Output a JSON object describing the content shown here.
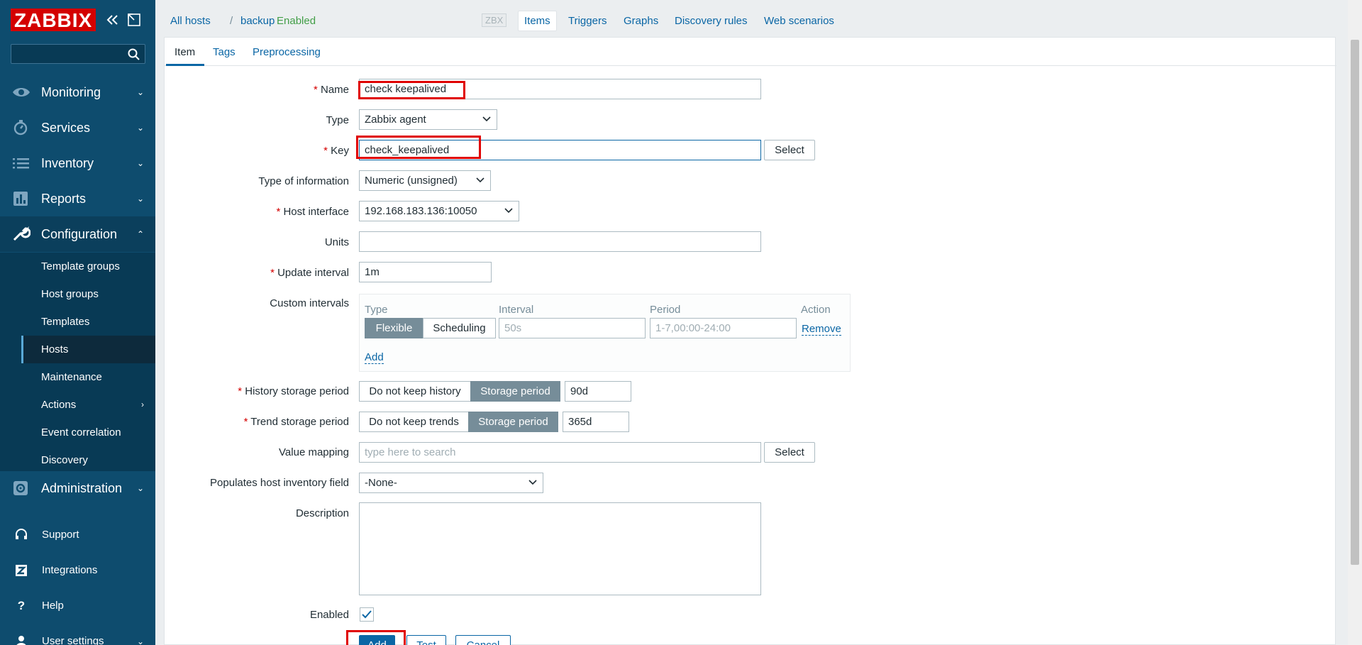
{
  "sidebar": {
    "logo": "ZABBIX",
    "search_placeholder": "",
    "menu": [
      {
        "label": "Monitoring",
        "icon": "eye-icon"
      },
      {
        "label": "Services",
        "icon": "stopwatch-icon"
      },
      {
        "label": "Inventory",
        "icon": "list-icon"
      },
      {
        "label": "Reports",
        "icon": "bar-chart-icon"
      },
      {
        "label": "Configuration",
        "icon": "wrench-icon"
      }
    ],
    "submenu": [
      "Template groups",
      "Host groups",
      "Templates",
      "Hosts",
      "Maintenance",
      "Actions",
      "Event correlation",
      "Discovery"
    ],
    "admin": {
      "label": "Administration",
      "icon": "gear-icon"
    },
    "utility": [
      {
        "label": "Support",
        "icon": "headset-icon"
      },
      {
        "label": "Integrations",
        "icon": "integrations-icon"
      },
      {
        "label": "Help",
        "icon": "help-icon"
      },
      {
        "label": "User settings",
        "icon": "user-icon"
      }
    ]
  },
  "breadcrumb": {
    "all_hosts": "All hosts",
    "sep": "/",
    "host": "backup",
    "status": "Enabled",
    "zbx": "ZBX",
    "items": "Items",
    "triggers": "Triggers",
    "graphs": "Graphs",
    "discovery": "Discovery rules",
    "web": "Web scenarios"
  },
  "form_tabs": [
    "Item",
    "Tags",
    "Preprocessing"
  ],
  "form": {
    "name_label": "Name",
    "name_value": "check keepalived",
    "type_label": "Type",
    "type_value": "Zabbix agent",
    "key_label": "Key",
    "key_value": "check_keepalived",
    "key_select": "Select",
    "toi_label": "Type of information",
    "toi_value": "Numeric (unsigned)",
    "hi_label": "Host interface",
    "hi_value": "192.168.183.136:10050",
    "units_label": "Units",
    "units_value": "",
    "update_label": "Update interval",
    "update_value": "1m",
    "custom_label": "Custom intervals",
    "custom": {
      "h_type": "Type",
      "h_interval": "Interval",
      "h_period": "Period",
      "h_action": "Action",
      "flexible": "Flexible",
      "scheduling": "Scheduling",
      "interval_ph": "50s",
      "period_ph": "1-7,00:00-24:00",
      "remove": "Remove",
      "add": "Add"
    },
    "history_label": "History storage period",
    "history_opt1": "Do not keep history",
    "history_opt2": "Storage period",
    "history_value": "90d",
    "trend_label": "Trend storage period",
    "trend_opt1": "Do not keep trends",
    "trend_opt2": "Storage period",
    "trend_value": "365d",
    "vm_label": "Value mapping",
    "vm_placeholder": "type here to search",
    "vm_select": "Select",
    "inv_label": "Populates host inventory field",
    "inv_value": "-None-",
    "desc_label": "Description",
    "desc_value": "",
    "enabled_label": "Enabled",
    "btn_add": "Add",
    "btn_test": "Test",
    "btn_cancel": "Cancel"
  },
  "colors": {
    "sidebar": "#0e4c6e",
    "accent": "#0a66a5",
    "required": "#d40000",
    "highlight": "#e00000"
  }
}
